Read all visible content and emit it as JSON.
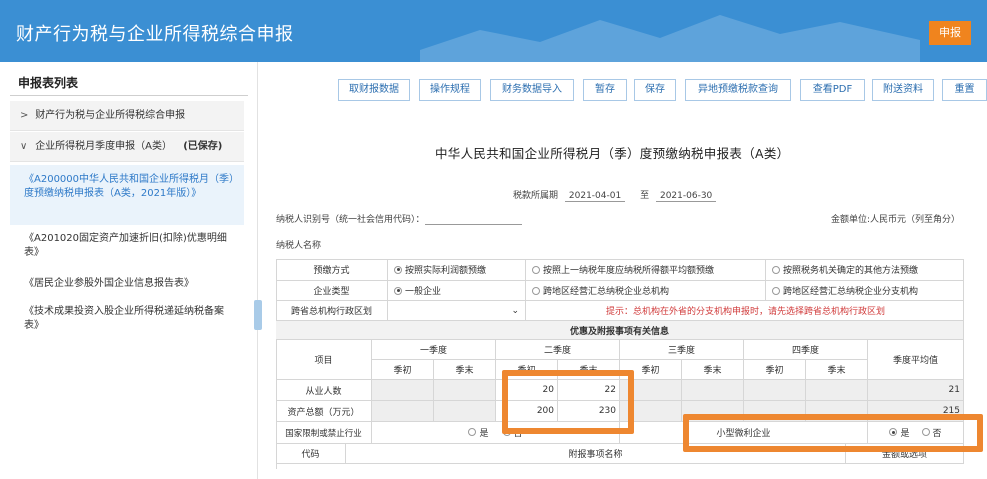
{
  "header": {
    "title": "财产行为税与企业所得税综合申报",
    "report_button": "申报"
  },
  "sidebar": {
    "title": "申报表列表",
    "groups": [
      {
        "label": "财产行为税与企业所得税综合申报"
      },
      {
        "label": "企业所得税月季度申报（A类）",
        "status": "(已保存)"
      }
    ],
    "items": [
      {
        "label": "《A200000中华人民共和国企业所得税月（季）度预缴纳税申报表（A类，2021年版）》"
      },
      {
        "label": "《A201020固定资产加速折旧(扣除)优惠明细表》"
      },
      {
        "label": "《居民企业参股外国企业信息报告表》"
      },
      {
        "label": "《技术成果投资入股企业所得税递延纳税备案表》"
      }
    ]
  },
  "toolbar": {
    "buttons": [
      "取财报数据",
      "操作规程",
      "财务数据导入",
      "暂存",
      "保存",
      "异地预缴税款查询",
      "查看PDF",
      "附送资料",
      "重置"
    ]
  },
  "form": {
    "title": "中华人民共和国企业所得税月（季）度预缴纳税申报表（A类）",
    "period_label": "税款所属期",
    "period_start": "2021-04-01",
    "period_to": "至",
    "period_end": "2021-06-30",
    "taxid_label": "纳税人识别号（统一社会信用代码）：",
    "unit_label": "金额单位:人民币元（列至角分）",
    "name_label": "纳税人名称"
  },
  "table": {
    "prepay_label": "预缴方式",
    "prepay_options": [
      "按照实际利润额预缴",
      "按照上一纳税年度应纳税所得额平均额预缴",
      "按照税务机关确定的其他方法预缴"
    ],
    "enterprise_label": "企业类型",
    "enterprise_options": [
      "一般企业",
      "跨地区经营汇总纳税企业总机构",
      "跨地区经营汇总纳税企业分支机构"
    ],
    "region_label": "跨省总机构行政区划",
    "region_hint": "提示：总机构在外省的分支机构申报时，请先选择跨省总机构行政区划",
    "section_title": "优惠及附报事项有关信息",
    "item_label": "项目",
    "quarters": [
      "一季度",
      "二季度",
      "三季度",
      "四季度"
    ],
    "avg_label": "季度平均值",
    "q_start": "季初",
    "q_end": "季末",
    "employees_label": "从业人数",
    "employees_q2_start": "20",
    "employees_q2_end": "22",
    "employees_avg": "21",
    "assets_label": "资产总额（万元）",
    "assets_q2_start": "200",
    "assets_q2_end": "230",
    "assets_avg": "215",
    "restricted_label": "国家限制或禁止行业",
    "yes": "是",
    "no": "否",
    "small_label": "小型微利企业",
    "code_label": "代码",
    "attached_label": "附报事项名称",
    "amount_label": "金额或选项"
  },
  "colors": {
    "header_bg": "#3b8fd3",
    "highlight": "#ee8730",
    "hint": "#d03a3a"
  }
}
